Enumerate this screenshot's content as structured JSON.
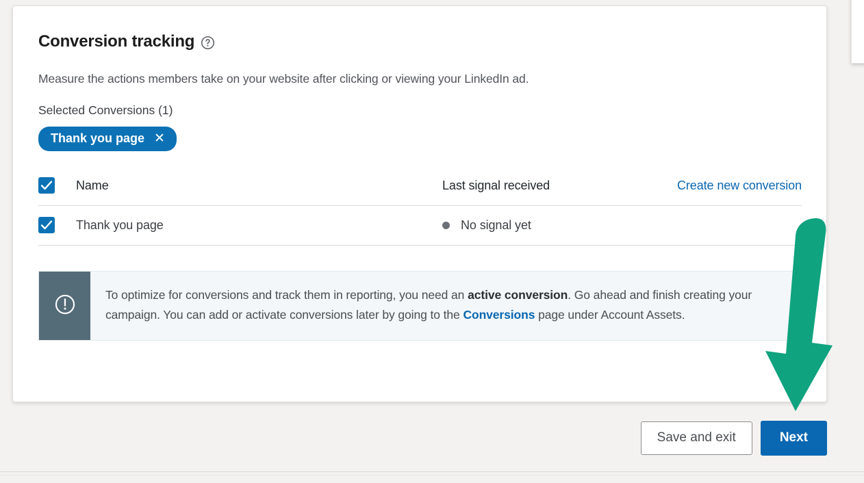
{
  "card": {
    "title": "Conversion tracking",
    "help_icon": "help-circle-icon",
    "description": "Measure the actions members take on your website after clicking or viewing your LinkedIn ad.",
    "selected_label": "Selected Conversions (1)",
    "pills": [
      {
        "label": "Thank you page",
        "remove_glyph": "✕"
      }
    ],
    "table": {
      "headers": {
        "name": "Name",
        "last_signal": "Last signal received",
        "create_link": "Create new conversion"
      },
      "rows": [
        {
          "name": "Thank you page",
          "signal": "No signal yet",
          "checked": true
        }
      ]
    },
    "alert": {
      "icon": "exclamation-circle-icon",
      "text_1": "To optimize for conversions and track them in reporting, you need an ",
      "bold_1": "active conversion",
      "text_2": ". Go ahead and finish creating your campaign. You can add or activate conversions later by going to the ",
      "link": "Conversions",
      "text_3": " page under Account Assets."
    }
  },
  "footer": {
    "save_and_exit": "Save and exit",
    "next": "Next"
  },
  "annotation": {
    "arrow": "down-arrow-annotation",
    "color": "#0fa37f"
  },
  "colors": {
    "accent_blue": "#0a67b1",
    "pill_blue": "#0c72b5",
    "alert_panel": "#546b78",
    "alert_bg": "#f3f7f9",
    "page_bg": "#f3f2f0",
    "arrow_green": "#0fa37f"
  }
}
